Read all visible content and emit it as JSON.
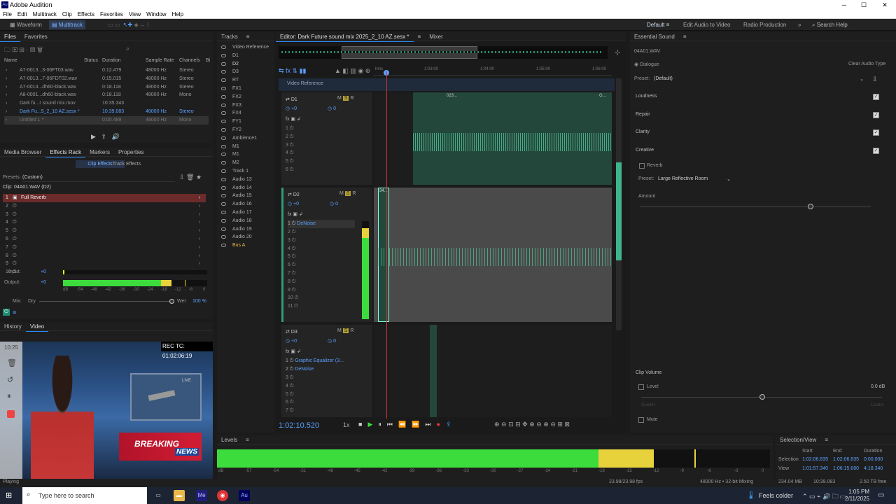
{
  "window": {
    "title": "Adobe Audition",
    "minimize": "─",
    "maximize": "☐",
    "close": "✕"
  },
  "menu": [
    "File",
    "Edit",
    "Multitrack",
    "Clip",
    "Effects",
    "Favorites",
    "View",
    "Window",
    "Help"
  ],
  "toolbar": {
    "waveform": "Waveform",
    "multitrack": "Multitrack",
    "workspaces": [
      "Default",
      "Edit Audio to Video",
      "Radio Production"
    ],
    "more": "»",
    "search": "Search Help"
  },
  "files": {
    "tabs": [
      "Files",
      "Favorites"
    ],
    "columns": [
      "Name",
      "Status",
      "Duration",
      "Sample Rate",
      "Channels",
      "Bi"
    ],
    "rows": [
      {
        "name": "A7-0013...3-06FT03.wav",
        "duration": "0:12.479",
        "rate": "48000 Hz",
        "channels": "Stereo"
      },
      {
        "name": "A7-0013...7-06FDT02.wav",
        "duration": "0:15.015",
        "rate": "48000 Hz",
        "channels": "Stereo"
      },
      {
        "name": "A7-0014...dh60-black.wav",
        "duration": "0:18.118",
        "rate": "48000 Hz",
        "channels": "Stereo"
      },
      {
        "name": "A8-0001...dh60-black.wav",
        "duration": "0:18.118",
        "rate": "48000 Hz",
        "channels": "Mono"
      },
      {
        "name": "Dark fu...r sound mix.mov",
        "duration": "10:35.343",
        "rate": "",
        "channels": ""
      },
      {
        "name": "Dark Fu...5_2_10 AZ.sesx *",
        "duration": "10:39.083",
        "rate": "48000 Hz",
        "channels": "Stereo"
      },
      {
        "name": "Untitled 1 *",
        "duration": "0:00.489",
        "rate": "48000 Hz",
        "channels": "Mono"
      }
    ]
  },
  "effects": {
    "tabs": [
      "Media Browser",
      "Effects Rack",
      "Markers",
      "Properties"
    ],
    "subtabs": [
      "Clip Effects",
      "Track Effects"
    ],
    "presets_label": "Presets:",
    "preset_value": "(Custom)",
    "clip_label": "Clip: 04A01.WAV (D2)",
    "slots": [
      "Full Reverb",
      "",
      "",
      "",
      "",
      "",
      "",
      "",
      "",
      ""
    ],
    "input_label": "Input:",
    "input_value": "+0",
    "output_label": "Output:",
    "output_value": "+0",
    "output_level": 0.85,
    "scale": [
      "dB",
      "-54",
      "-48",
      "-42",
      "-36",
      "-30",
      "-24",
      "-18",
      "-12",
      "-6",
      "0"
    ],
    "mix_label": "Mix:",
    "dry": "Dry",
    "wet": "Wet",
    "wet_value": "100 %"
  },
  "video": {
    "tabs": [
      "History",
      "Video"
    ],
    "time_label": "10:25",
    "timecode": "REC TC: 01:02:06:19",
    "banner": "BREAKING",
    "banner_sub": "NEWS",
    "live": "LIVE"
  },
  "tracks_panel": {
    "title": "Tracks",
    "items": [
      "Video Reference",
      "D1",
      "D2",
      "D3",
      "RT",
      "FX1",
      "FX2",
      "FX3",
      "FX4",
      "FY1",
      "FY2",
      "Ambience1",
      "M1",
      "M1",
      "M2",
      "Track 1",
      "Audio 13",
      "Audio 14",
      "Audio 15",
      "Audio 16",
      "Audio 17",
      "Audio 18",
      "Audio 19",
      "Audio 20",
      "Bus A"
    ]
  },
  "editor": {
    "tab": "Editor: Dark Future sound mix 2025_2_10 AZ.sesx *",
    "mixer": "Mixer",
    "ruler": [
      "hms",
      "1:03:00",
      "1:04:00",
      "1:05:00",
      "1:06:00"
    ],
    "video_ref": "Video Reference",
    "timecode": "1:02:10.520",
    "speed": "1x",
    "tracks": [
      {
        "name": "D1",
        "vol": "+0",
        "pan": "0",
        "fx": []
      },
      {
        "name": "D2",
        "vol": "+0",
        "pan": "0",
        "fx": [
          "DeNoise"
        ]
      },
      {
        "name": "D3",
        "vol": "+0",
        "pan": "0",
        "fx": [
          "Graphic Equalizer (3...",
          "DeNoise"
        ]
      }
    ],
    "clip_labels": [
      "023...",
      "G...",
      "34..."
    ]
  },
  "essential": {
    "title": "Essential Sound",
    "clip": "04A01.WAV",
    "type": "Dialogue",
    "clear": "Clear Audio Type",
    "preset_label": "Preset:",
    "preset_value": "(Default)",
    "sections": [
      "Loudness",
      "Repair",
      "Clarity",
      "Creative"
    ],
    "reverb_label": "Reverb",
    "reverb_preset_label": "Preset:",
    "reverb_preset_value": "Large Reflective Room",
    "amount_label": "Amount",
    "amount_value": 0.74,
    "clip_volume": "Clip Volume",
    "level_label": "Level",
    "level_value": "0.0 dB",
    "quieter": "Quieter",
    "louder": "Louder",
    "mute_label": "Mute"
  },
  "levels": {
    "title": "Levels",
    "green_fraction": 0.69,
    "yellow_fraction": 0.1,
    "scale": [
      "dB",
      "-57",
      "-54",
      "-51",
      "-48",
      "-45",
      "-42",
      "-39",
      "-36",
      "-33",
      "-30",
      "-27",
      "-24",
      "-21",
      "-18",
      "-15",
      "-12",
      "-9",
      "-6",
      "-3",
      "0"
    ]
  },
  "selection": {
    "title": "Selection/View",
    "columns": [
      "Start",
      "End",
      "Duration"
    ],
    "rows": [
      {
        "label": "Selection",
        "start": "1:02:06.835",
        "end": "1:02:06.835",
        "duration": "0:00.000"
      },
      {
        "label": "View",
        "start": "1:01:57.340",
        "end": "1:06:15.680",
        "duration": "4:18.340"
      }
    ]
  },
  "status": {
    "left": "Playing",
    "fps": "23.98/23.98 fps",
    "format": "48000 Hz • 32-bit Mixing",
    "mem": "234.04 MB",
    "dur": "10:39.083",
    "free": "2.50 TB free"
  },
  "taskbar": {
    "search": "Type here to search",
    "weather": "Feels colder",
    "time": "1:05 PM",
    "date": "2/11/2025"
  }
}
